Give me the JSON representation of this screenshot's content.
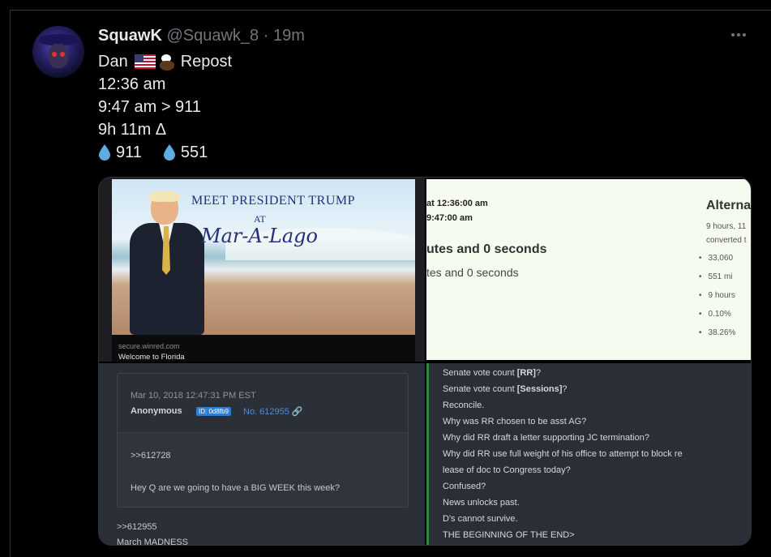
{
  "tweet": {
    "display_name": "SquawK",
    "handle": "@Squawk_8",
    "separator": "·",
    "time": "19m",
    "lines": {
      "line1_prefix": "Dan",
      "line1_suffix": "Repost",
      "line2": "12:36 am",
      "line3": "9:47 am > 911",
      "line4": "9h 11m  Δ",
      "drop1": "911",
      "drop2": "551"
    }
  },
  "media": {
    "ad": {
      "title": "MEET PRESIDENT TRUMP",
      "at": "AT",
      "venue": "Mar-A-Lago",
      "url": "secure.winred.com",
      "description": "Welcome to Florida"
    },
    "calculator": {
      "line1": "at 12:36:00 am",
      "line2": "9:47:00 am",
      "heading": "utes and 0 seconds",
      "subheading": "tes and 0 seconds",
      "alt_title": "Alterna",
      "alt_line1": "9 hours, 11",
      "alt_line2": "converted t",
      "bullets": [
        "33,060",
        "551 mi",
        "9 hours",
        "0.10%",
        "38.26%"
      ]
    },
    "post": {
      "date": "Mar 10, 2018 12:47:31 PM EST",
      "author": "Anonymous",
      "id_badge": "ID: 0d8fb9",
      "number": "No. 612955 🔗",
      "ref": ">>612728",
      "message": "Hey Q are we going to have a BIG WEEK this week?",
      "reply_ref": ">>612955",
      "reply_msg": "March MADNESS"
    },
    "drop": {
      "line1_prefix": "Senate vote count ",
      "line1_bold": "[RR]",
      "line1_suffix": "?",
      "line2_prefix": "Senate vote count ",
      "line2_bold": "[Sessions]",
      "line2_suffix": "?",
      "line3": "Reconcile.",
      "line4": "Why was RR chosen to be asst AG?",
      "line5": "Why did RR draft a letter supporting JC termination?",
      "line6": "Why did RR use full weight of his office to attempt to block re",
      "line7": "lease of doc to Congress today?",
      "line8": "Confused?",
      "line9": "News unlocks past.",
      "line10": "D's cannot survive.",
      "line11": "THE BEGINNING OF THE END>"
    }
  }
}
